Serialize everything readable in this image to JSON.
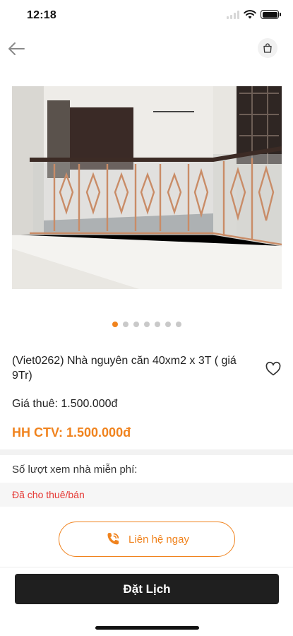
{
  "status_bar": {
    "time": "12:18"
  },
  "listing": {
    "title": "(Viet0262) Nhà nguyên căn 40xm2 x 3T ( giá 9Tr)",
    "rent_price": "Giá thuê: 1.500.000đ",
    "commission": "HH CTV: 1.500.000đ",
    "free_views_label": "Số lượt xem nhà miễn phí:",
    "status": "Đã cho thuê/bán"
  },
  "gallery": {
    "image_count": 7,
    "active_index": 0
  },
  "actions": {
    "contact_label": "Liên hệ ngay",
    "book_label": "Đặt Lịch"
  },
  "icons": {
    "back": "back-arrow-icon",
    "cart": "shopping-bag-icon",
    "favorite": "heart-outline-icon",
    "phone": "phone-ringing-icon"
  },
  "colors": {
    "accent": "#f0831e",
    "status_red": "#e53935",
    "primary_button": "#1f1f1f"
  }
}
